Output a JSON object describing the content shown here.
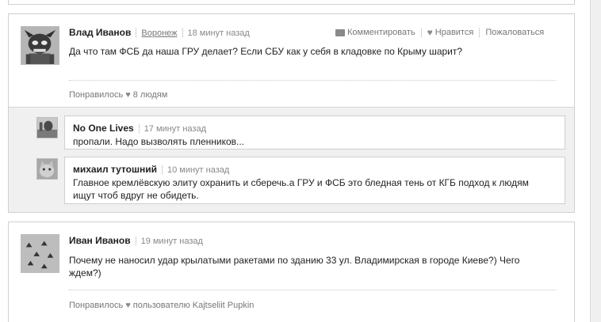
{
  "comments": [
    {
      "author": "Влад Иванов",
      "city": "Воронеж",
      "time": "18 минут назад",
      "actions": {
        "comment": "Комментировать",
        "like": "Нравится",
        "report": "Пожаловаться"
      },
      "text": "Да что там ФСБ да наша ГРУ делает? Если СБУ как у себя в кладовке по Крыму шарит?",
      "likes_prefix": "Понравилось",
      "likes_suffix": "8 людям",
      "replies": [
        {
          "author": "No One Lives",
          "time": "17 минут назад",
          "text": "пропали. Надо вызволять пленников..."
        },
        {
          "author": "михаил тутошний",
          "time": "10 минут назад",
          "text": "Главное кремлёвскую элиту охранить и сберечь.а ГРУ и ФСБ это бледная тень от КГБ подход к людям ищут чтоб вдруг не обидеть."
        }
      ]
    },
    {
      "author": "Иван Иванов",
      "time": "19 минут назад",
      "text": "Почему не наносил удар крылатыми ракетами по зданию 33 ул. Владимирская в городе Киеве?) Чего ждем?)",
      "likes_prefix": "Понравилось",
      "likes_suffix": "пользователю Kajtseliit Pupkin"
    }
  ]
}
